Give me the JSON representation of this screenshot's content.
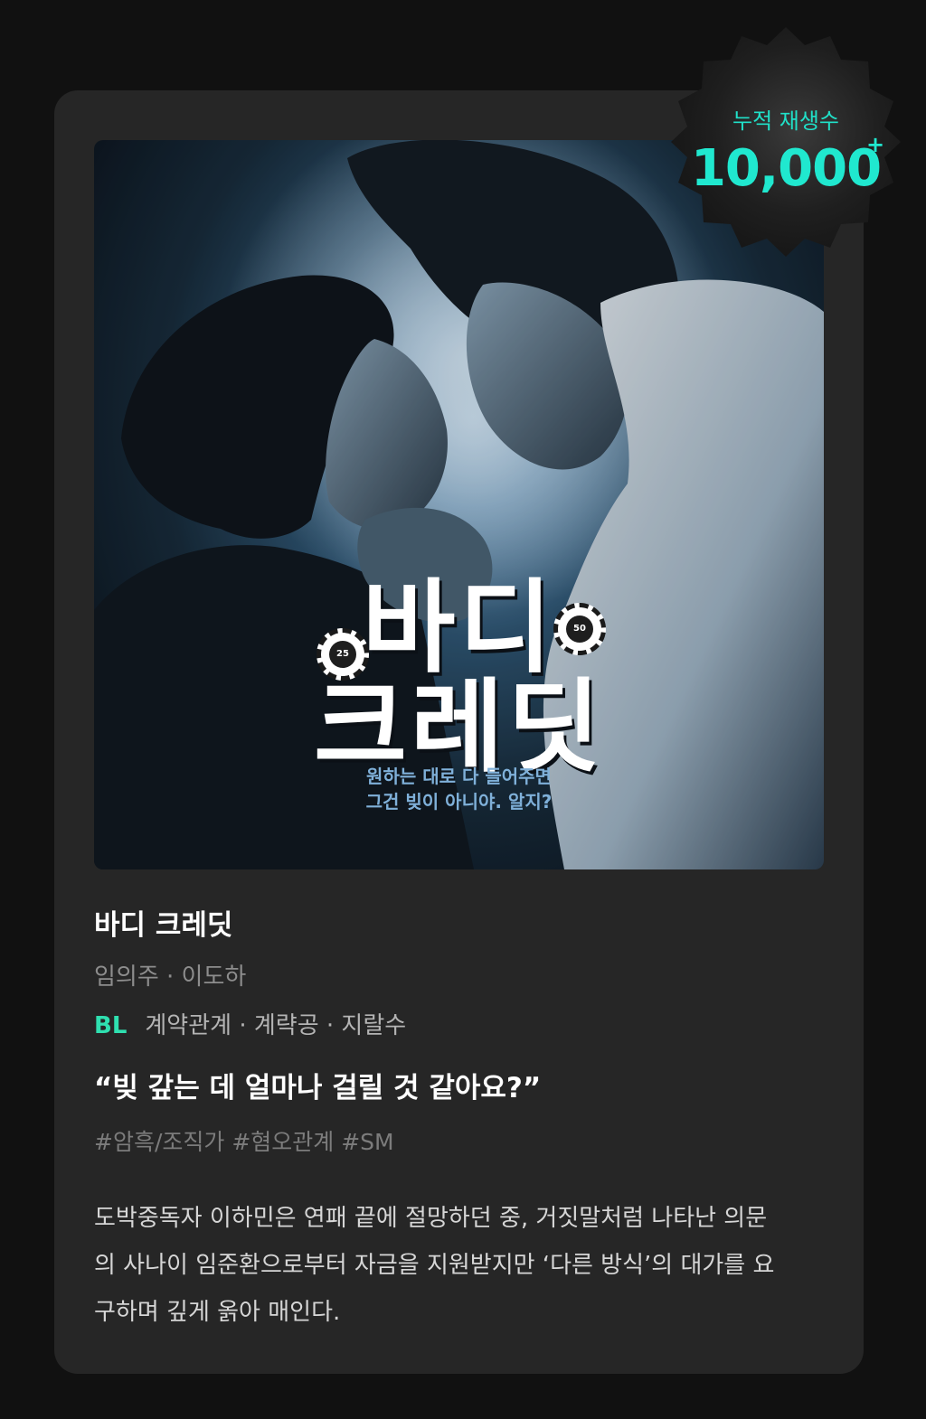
{
  "badge": {
    "label": "누적 재생수",
    "count": "10,000",
    "plus": "+"
  },
  "cover": {
    "title_line1": "바디",
    "title_line2": "크레딧",
    "chip_left": "25",
    "chip_right": "50",
    "tagline_line1": "원하는 대로 다 들어주면",
    "tagline_line2": "그건 빚이 아니야. 알지?"
  },
  "work": {
    "title": "바디 크레딧",
    "authors": "임의주 · 이도하",
    "genre": "BL",
    "keywords": "계약관계 · 계략공 · 지랄수",
    "quote": "“빚 갚는 데 얼마나 걸릴 것 같아요?”",
    "hashtags": "#암흑/조직가 #혐오관계 #SM",
    "description_line1": "도박중독자 이하민은 연패 끝에 절망하던 중, 거짓말처럼 나타난 의문",
    "description_line2": "의 사나이 임준환으로부터 자금을 지원받지만 ‘다른 방식’의 대가를 요",
    "description_line3": "구하며 깊게 옭아 매인다."
  },
  "colors": {
    "background": "#111111",
    "card": "#262626",
    "accent_teal": "#20e8cf",
    "genre_green": "#2fe0b0"
  }
}
